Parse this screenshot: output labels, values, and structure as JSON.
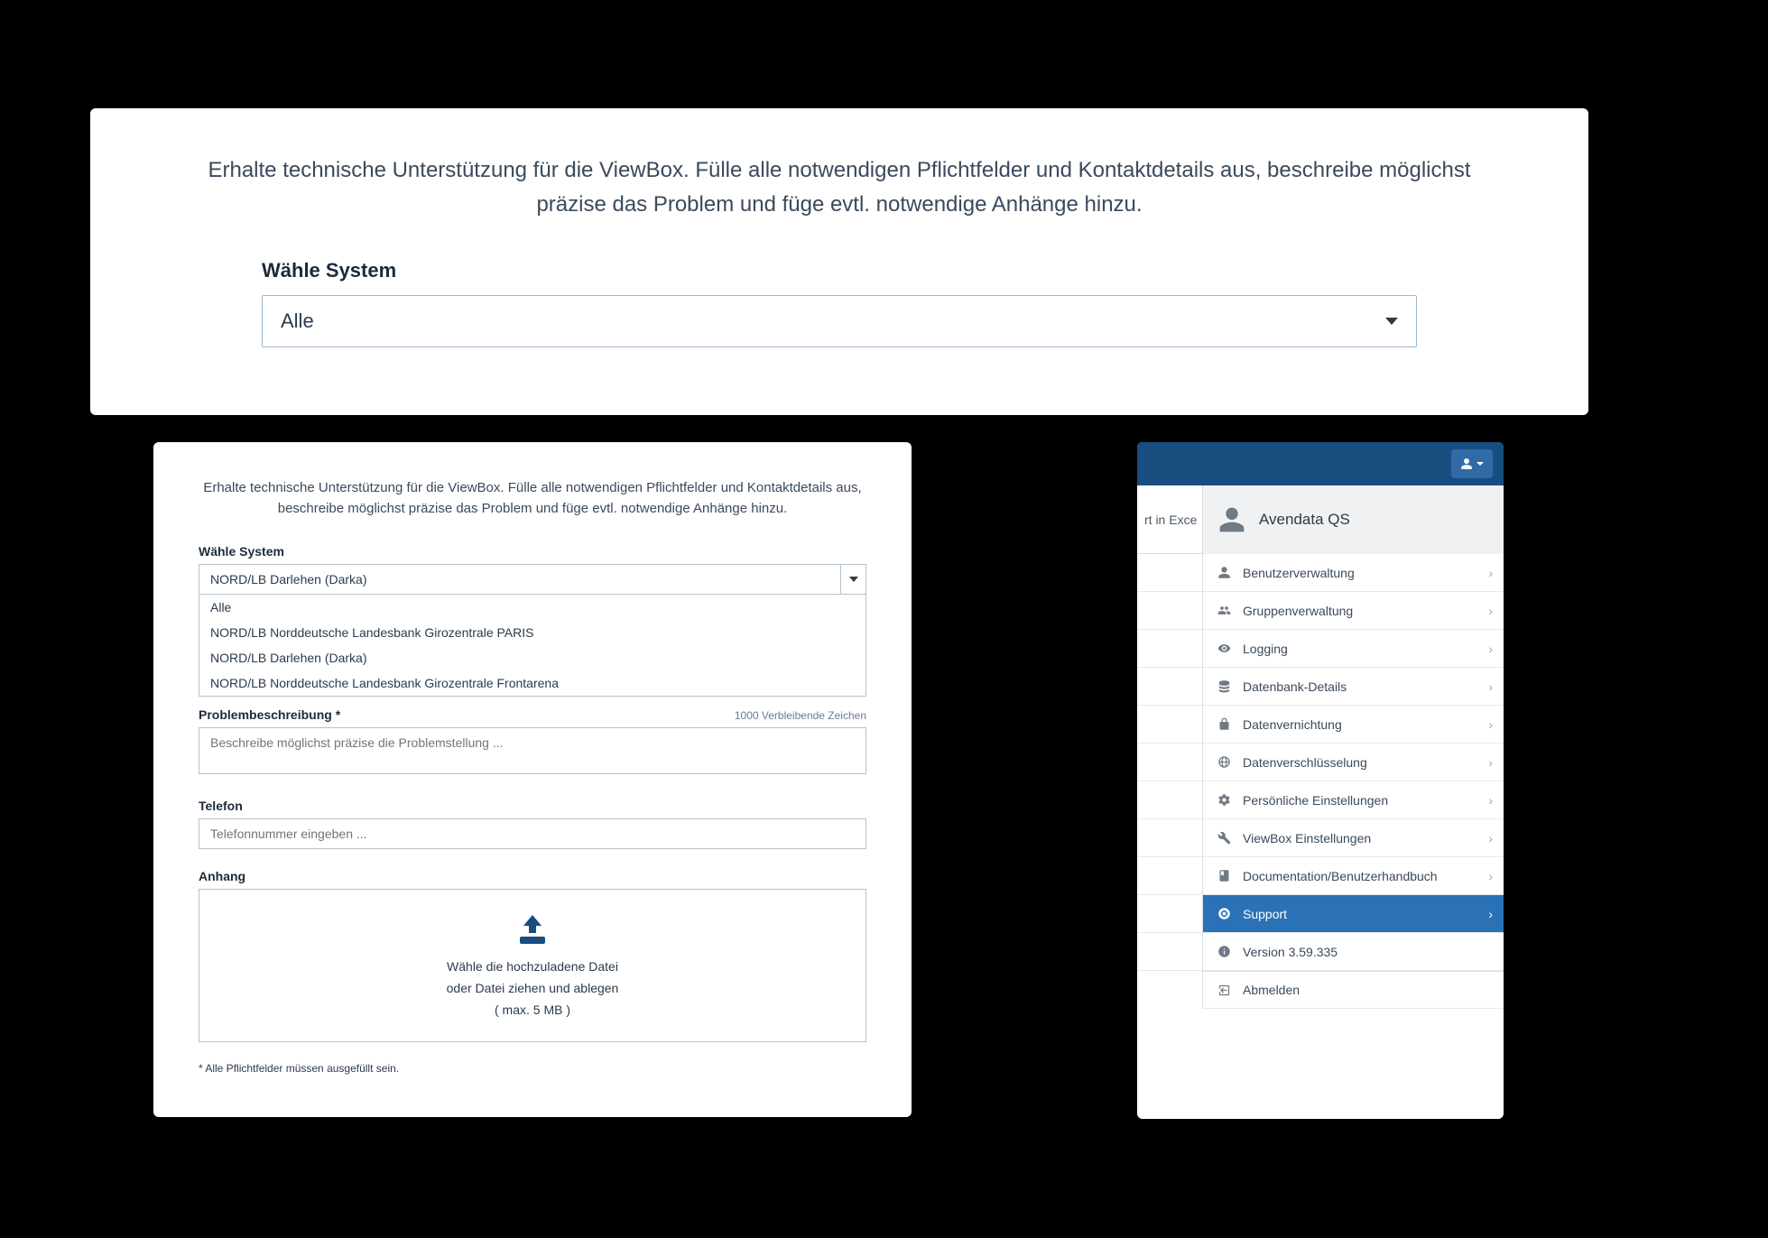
{
  "top": {
    "intro": "Erhalte technische Unterstützung für die ViewBox. Fülle alle notwendigen Pflichtfelder und Kontaktdetails aus, beschreibe möglichst präzise das Problem und füge evtl. notwendige Anhänge hinzu.",
    "system_label": "Wähle System",
    "system_value": "Alle"
  },
  "form": {
    "intro": "Erhalte technische Unterstützung für die ViewBox. Fülle alle notwendigen Pflichtfelder und Kontaktdetails aus, beschreibe möglichst präzise das Problem und füge evtl. notwendige Anhänge hinzu.",
    "system_label": "Wähle System",
    "system_value": "NORD/LB Darlehen (Darka)",
    "options": [
      "Alle",
      "NORD/LB Norddeutsche Landesbank Girozentrale PARIS",
      "NORD/LB Darlehen (Darka)",
      "NORD/LB Norddeutsche Landesbank Girozentrale Frontarena"
    ],
    "desc_label": "Problembeschreibung *",
    "char_count": "1000 Verbleibende Zeichen",
    "desc_placeholder": "Beschreibe möglichst präzise die Problemstellung ...",
    "phone_label": "Telefon",
    "phone_placeholder": "Telefonnummer eingeben ...",
    "attach_label": "Anhang",
    "upload_line1": "Wähle die hochzuladene Datei",
    "upload_line2": "oder Datei ziehen und ablegen",
    "upload_line3": "( max. 5 MB )",
    "footnote": "* Alle Pflichtfelder müssen ausgefüllt sein."
  },
  "menu": {
    "bg_fragment": "rt in Exce",
    "user_name": "Avendata QS",
    "items": [
      {
        "icon": "user",
        "label": "Benutzerverwaltung",
        "chev": true
      },
      {
        "icon": "group",
        "label": "Gruppenverwaltung",
        "chev": true
      },
      {
        "icon": "eye",
        "label": "Logging",
        "chev": true
      },
      {
        "icon": "db",
        "label": "Datenbank-Details",
        "chev": true
      },
      {
        "icon": "lock",
        "label": "Datenvernichtung",
        "chev": true
      },
      {
        "icon": "globe",
        "label": "Datenverschlüsselung",
        "chev": true
      },
      {
        "icon": "gear",
        "label": "Persönliche Einstellungen",
        "chev": true
      },
      {
        "icon": "wrench",
        "label": "ViewBox Einstellungen",
        "chev": true
      },
      {
        "icon": "book",
        "label": "Documentation/Benutzerhandbuch",
        "chev": true
      },
      {
        "icon": "life",
        "label": "Support",
        "chev": true,
        "active": true
      },
      {
        "icon": "info",
        "label": "Version 3.59.335",
        "chev": false
      },
      {
        "icon": "logout",
        "label": "Abmelden",
        "chev": false,
        "logout": true
      }
    ]
  }
}
